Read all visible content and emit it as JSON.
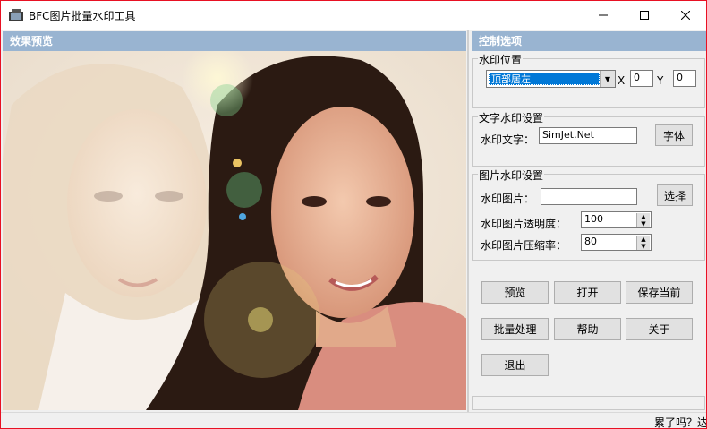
{
  "window": {
    "title": "BFC图片批量水印工具"
  },
  "preview": {
    "header": "效果预览"
  },
  "panel": {
    "header": "控制选项",
    "position_group": {
      "legend": "水印位置",
      "position_value": "顶部居左",
      "x_label": "X",
      "x_value": "0",
      "y_label": "Y",
      "y_value": "0"
    },
    "text_group": {
      "legend": "文字水印设置",
      "text_label": "水印文字：",
      "text_value": "SimJet.Net",
      "font_button": "字体"
    },
    "image_group": {
      "legend": "图片水印设置",
      "image_label": "水印图片：",
      "image_value": "",
      "select_button": "选择",
      "opacity_label": "水印图片透明度：",
      "opacity_value": "100",
      "compress_label": "水印图片压缩率：",
      "compress_value": "80"
    },
    "buttons": {
      "preview": "预览",
      "open": "打开",
      "save_current": "保存当前",
      "batch": "批量处理",
      "help": "帮助",
      "about": "关于",
      "exit": "退出"
    }
  },
  "status": {
    "text": "累了吗？达"
  },
  "colors": {
    "header_bg": "#99b4d1",
    "selection": "#0078d7",
    "window_border": "#e81123"
  },
  "icons": [
    "app-icon",
    "minimize-icon",
    "maximize-icon",
    "close-icon",
    "dropdown-arrow-icon",
    "spin-icon"
  ]
}
